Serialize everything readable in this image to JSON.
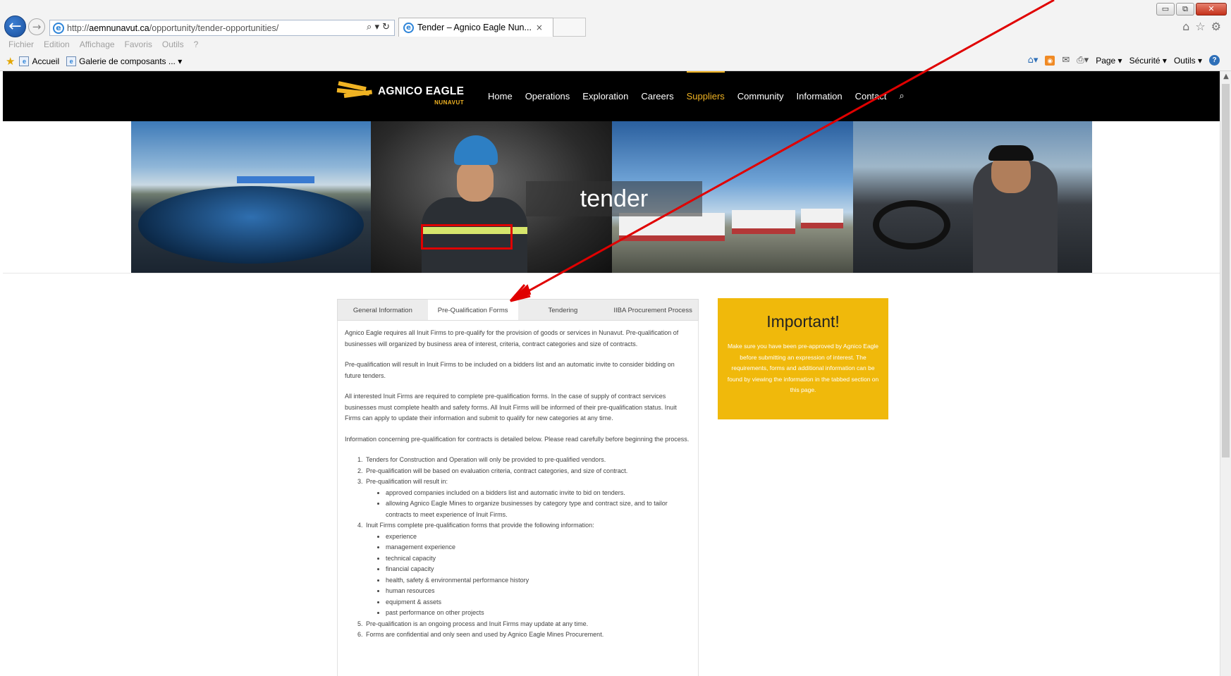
{
  "browser": {
    "address_prefix": "http://",
    "address_host": "aemnunavut.ca",
    "address_path": "/opportunity/tender-opportunities/",
    "address_tools": "⌕ ▾ ↻",
    "tab_title": "Tender – Agnico Eagle Nun...",
    "tab_close": "×",
    "window_controls": {
      "minimize": "▭",
      "restore": "⧉",
      "close": "✕"
    },
    "right_icons": [
      "⌂",
      "☆",
      "⚙"
    ],
    "menu": [
      "Fichier",
      "Edition",
      "Affichage",
      "Favoris",
      "Outils",
      "?"
    ],
    "favorites": [
      {
        "label": "Accueil"
      },
      {
        "label": "Galerie de composants ... ▾"
      }
    ],
    "commands": {
      "page": "Page ▾",
      "security": "Sécurité ▾",
      "tools": "Outils ▾"
    }
  },
  "site": {
    "logo_name": "AGNICO EAGLE",
    "logo_sub": "NUNAVUT",
    "nav": [
      "Home",
      "Operations",
      "Exploration",
      "Careers",
      "Suppliers",
      "Community",
      "Information",
      "Contact"
    ],
    "nav_active": "Suppliers",
    "search_icon": "🔍"
  },
  "hero": {
    "caption": "tender"
  },
  "tabs": {
    "items": [
      "General Information",
      "Pre-Qualification Forms",
      "Tendering",
      "IIBA Procurement Process"
    ],
    "active": "Pre-Qualification Forms"
  },
  "tab_content": {
    "p1": "Agnico Eagle requires all Inuit Firms to pre-qualify for the provision of goods or services in Nunavut. Pre-qualification of businesses will organized by business area of interest, criteria, contract categories and size of contracts.",
    "p2": "Pre-qualification will result in Inuit Firms to be included on a bidders list and an automatic invite to consider bidding on future tenders.",
    "p3": "All interested Inuit Firms are required to complete pre-qualification forms. In the case of supply of contract services businesses must complete health and safety forms. All Inuit Firms will be informed of their pre-qualification status. Inuit Firms can apply to update their information and submit to qualify for new categories at any time.",
    "p4": "Information concerning pre-qualification for contracts is detailed below. Please read carefully before beginning the process.",
    "list": {
      "item1": "Tenders for Construction and Operation will only be provided to pre-qualified vendors.",
      "item2": "Pre-qualification will be based on evaluation criteria, contract categories, and size of contract.",
      "item3": "Pre-qualification will result in:",
      "item3_sub": [
        "approved companies included on a bidders list and automatic invite to bid on tenders.",
        "allowing Agnico Eagle Mines to organize businesses by category type and contract size, and to tailor contracts to meet experience of Inuit Firms."
      ],
      "item4": "Inuit Firms complete pre-qualification forms that provide the following information:",
      "item4_sub": [
        "experience",
        "management experience",
        "technical capacity",
        "financial capacity",
        "health, safety & environmental performance history",
        "human resources",
        "equipment & assets",
        "past performance on other projects"
      ],
      "item5": "Pre-qualification is an ongoing process and Inuit Firms may update at any time.",
      "item6": "Forms are confidential and only seen and used by Agnico Eagle Mines Procurement."
    }
  },
  "important": {
    "title": "Important!",
    "text": "Make sure you have been pre-approved by Agnico Eagle before submitting an expression of interest. The requirements, forms and additional information can be found by viewing the information in the tabbed section on this page."
  },
  "colors": {
    "accent_gold": "#f0b323",
    "important_bg": "#f0b90b",
    "annotation_red": "#e00000"
  }
}
